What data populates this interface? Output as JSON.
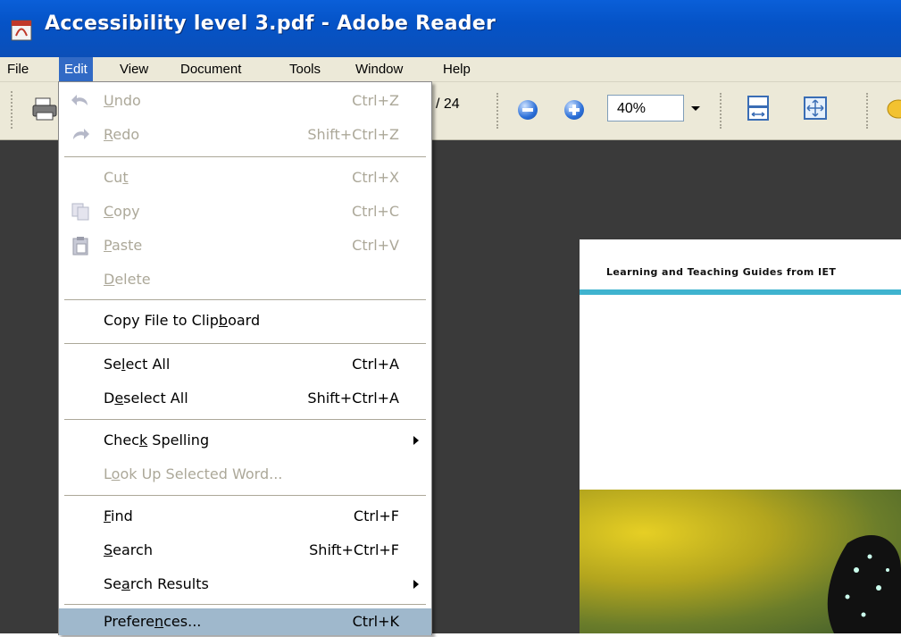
{
  "window": {
    "title": "Accessibility level 3.pdf - Adobe Reader"
  },
  "menubar": {
    "items": [
      "File",
      "Edit",
      "View",
      "Document",
      "Tools",
      "Window",
      "Help"
    ],
    "active": "Edit"
  },
  "toolbar": {
    "page_total": "/ 24",
    "zoom_value": "40%",
    "icons": [
      "printer-icon",
      "zoom-out-icon",
      "zoom-in-icon",
      "fit-width-icon",
      "fit-page-icon",
      "hand-tool-icon"
    ]
  },
  "edit_menu": {
    "undo": {
      "pre": "",
      "u": "U",
      "post": "ndo",
      "shortcut": "Ctrl+Z"
    },
    "redo": {
      "pre": "",
      "u": "R",
      "post": "edo",
      "shortcut": "Shift+Ctrl+Z"
    },
    "cut": {
      "pre": "Cu",
      "u": "t",
      "post": "",
      "shortcut": "Ctrl+X"
    },
    "copy": {
      "pre": "",
      "u": "C",
      "post": "opy",
      "shortcut": "Ctrl+C"
    },
    "paste": {
      "pre": "",
      "u": "P",
      "post": "aste",
      "shortcut": "Ctrl+V"
    },
    "delete": {
      "pre": "",
      "u": "D",
      "post": "elete"
    },
    "copy_clipboard": {
      "pre": "Copy File to Clip",
      "u": "b",
      "post": "oard"
    },
    "select_all": {
      "pre": "Se",
      "u": "l",
      "post": "ect All",
      "shortcut": "Ctrl+A"
    },
    "deselect_all": {
      "pre": "D",
      "u": "e",
      "post": "select All",
      "shortcut": "Shift+Ctrl+A"
    },
    "check_spelling": {
      "pre": "Chec",
      "u": "k",
      "post": " Spelling"
    },
    "look_up": {
      "pre": "L",
      "u": "o",
      "post": "ok Up Selected Word..."
    },
    "find": {
      "pre": "",
      "u": "F",
      "post": "ind",
      "shortcut": "Ctrl+F"
    },
    "search": {
      "pre": "",
      "u": "S",
      "post": "earch",
      "shortcut": "Shift+Ctrl+F"
    },
    "search_results": {
      "pre": "Se",
      "u": "a",
      "post": "rch Results"
    },
    "preferences": {
      "pre": "Prefere",
      "u": "n",
      "post": "ces...",
      "shortcut": "Ctrl+K"
    }
  },
  "document": {
    "header_text": "Learning and Teaching Guides from IET",
    "accent_color": "#3fb3cf"
  },
  "colors": {
    "titlebar": "#0553c7",
    "menu_highlight": "#316ac5",
    "selected_item": "#9fb8cc",
    "disabled_text": "#aca899"
  }
}
